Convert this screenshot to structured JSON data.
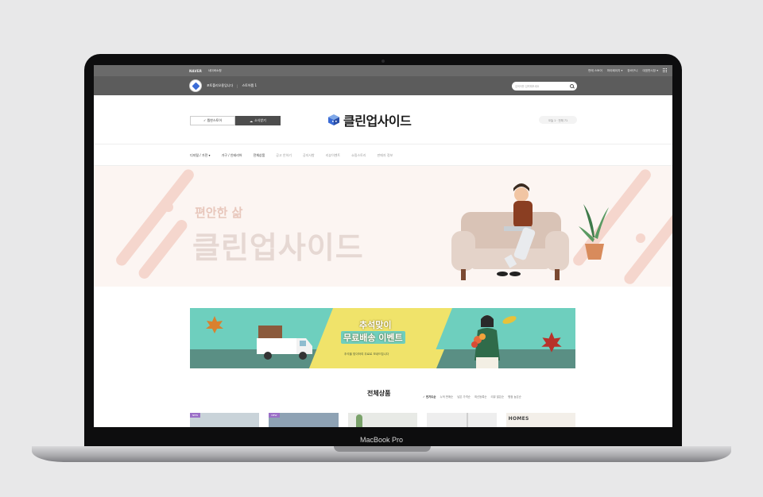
{
  "device": {
    "label": "MacBook Pro"
  },
  "utility_bar": {
    "naver_logo": "NAVER",
    "naver_pay": "네이버쇼핑",
    "links": [
      "판매 스토어",
      "마이페이지 ▾",
      "장바구니",
      "대표판시장 ▾"
    ]
  },
  "store_bar": {
    "store_name": "포토폴리오용입니다",
    "store_grade": "스토어찜 1",
    "search_placeholder": "검색어를 입력해보세요"
  },
  "header": {
    "favorite_label": "✓ 찜한스토어",
    "news_label": "소식받기",
    "logo_text": "클린업사이드",
    "counter": "오늘 1 · 전체 71"
  },
  "nav": {
    "items": [
      "디지털 / 가전 ▾",
      "가구 / 인테리어",
      "전체상품",
      "공고 안하기",
      "공지사항",
      "리뷰이벤트",
      "쇼핑스토리",
      "판매자 정보"
    ]
  },
  "hero": {
    "subtitle": "편안한 삶",
    "title": "클린업사이드"
  },
  "event_banner": {
    "title_line1": "추석맞이",
    "title_line2": "무료배송 이벤트",
    "description": "추석을 맞이하여 무료로 보내드립니다"
  },
  "products_section": {
    "title": "전체상품",
    "sort_tabs": [
      "✓ 인기도순",
      "누적 판매순",
      "낮은 가격순",
      "최신등록순",
      "리뷰 많은순",
      "평점 높은순"
    ],
    "items": [
      {
        "badge": "NEW"
      },
      {
        "badge": "NEW"
      },
      {
        "badge": ""
      },
      {
        "badge": ""
      },
      {
        "badge": "",
        "label": "HOMES"
      }
    ]
  },
  "colors": {
    "topbar": "#6a6a6a",
    "hero_bg": "#fcf5f2",
    "event_green": "#6ecfbe",
    "event_yellow": "#f0e36a",
    "badge_purple": "#9b6fc7"
  }
}
